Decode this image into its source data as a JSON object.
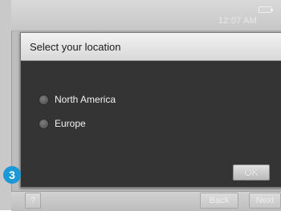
{
  "statusbar": {
    "time": "12:07 AM",
    "battery_icon": "battery-icon"
  },
  "dialog": {
    "title": "Select your location",
    "options": [
      {
        "label": "North America",
        "selected": false
      },
      {
        "label": "Europe",
        "selected": false
      }
    ],
    "ok_label": "OK"
  },
  "bottombar": {
    "help_label": "?",
    "back_label": "Back",
    "next_label": "Next"
  },
  "badge": {
    "number": "3",
    "color": "#1d98d6"
  }
}
